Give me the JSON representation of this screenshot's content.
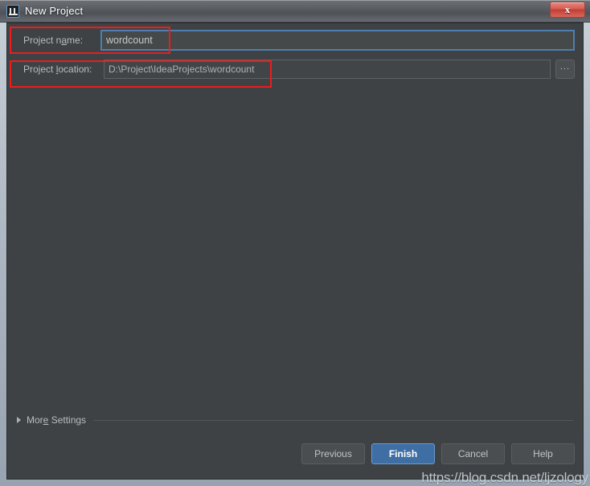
{
  "window": {
    "title": "New Project",
    "app_icon": "intellij-idea-icon",
    "close_label": "x"
  },
  "form": {
    "project_name": {
      "label_before": "Project n",
      "label_mnemonic": "a",
      "label_after": "me:",
      "value": "wordcount",
      "placeholder": ""
    },
    "project_location": {
      "label_before": "Project ",
      "label_mnemonic": "l",
      "label_after": "ocation:",
      "value": "D:\\Project\\IdeaProjects\\wordcount",
      "placeholder": "",
      "browse_label": "..."
    }
  },
  "more_settings": {
    "label_before": "Mor",
    "label_mnemonic": "e",
    "label_after": " Settings",
    "expanded": false
  },
  "footer": {
    "buttons": [
      {
        "label": "Previous",
        "primary": false,
        "enabled": true
      },
      {
        "label": "Finish",
        "primary": true,
        "enabled": true
      },
      {
        "label": "Cancel",
        "primary": false,
        "enabled": true
      },
      {
        "label": "Help",
        "primary": false,
        "enabled": true
      }
    ]
  },
  "watermark": {
    "text": "https://blog.csdn.net/ljzology"
  },
  "colors": {
    "dialog_background": "#3f4244",
    "input_background": "#45494a",
    "focus_border": "#4e7fb0",
    "primary_button": "#3f6ea4",
    "annotation_red": "#ef1c1c",
    "title_text": "#ffffff"
  }
}
